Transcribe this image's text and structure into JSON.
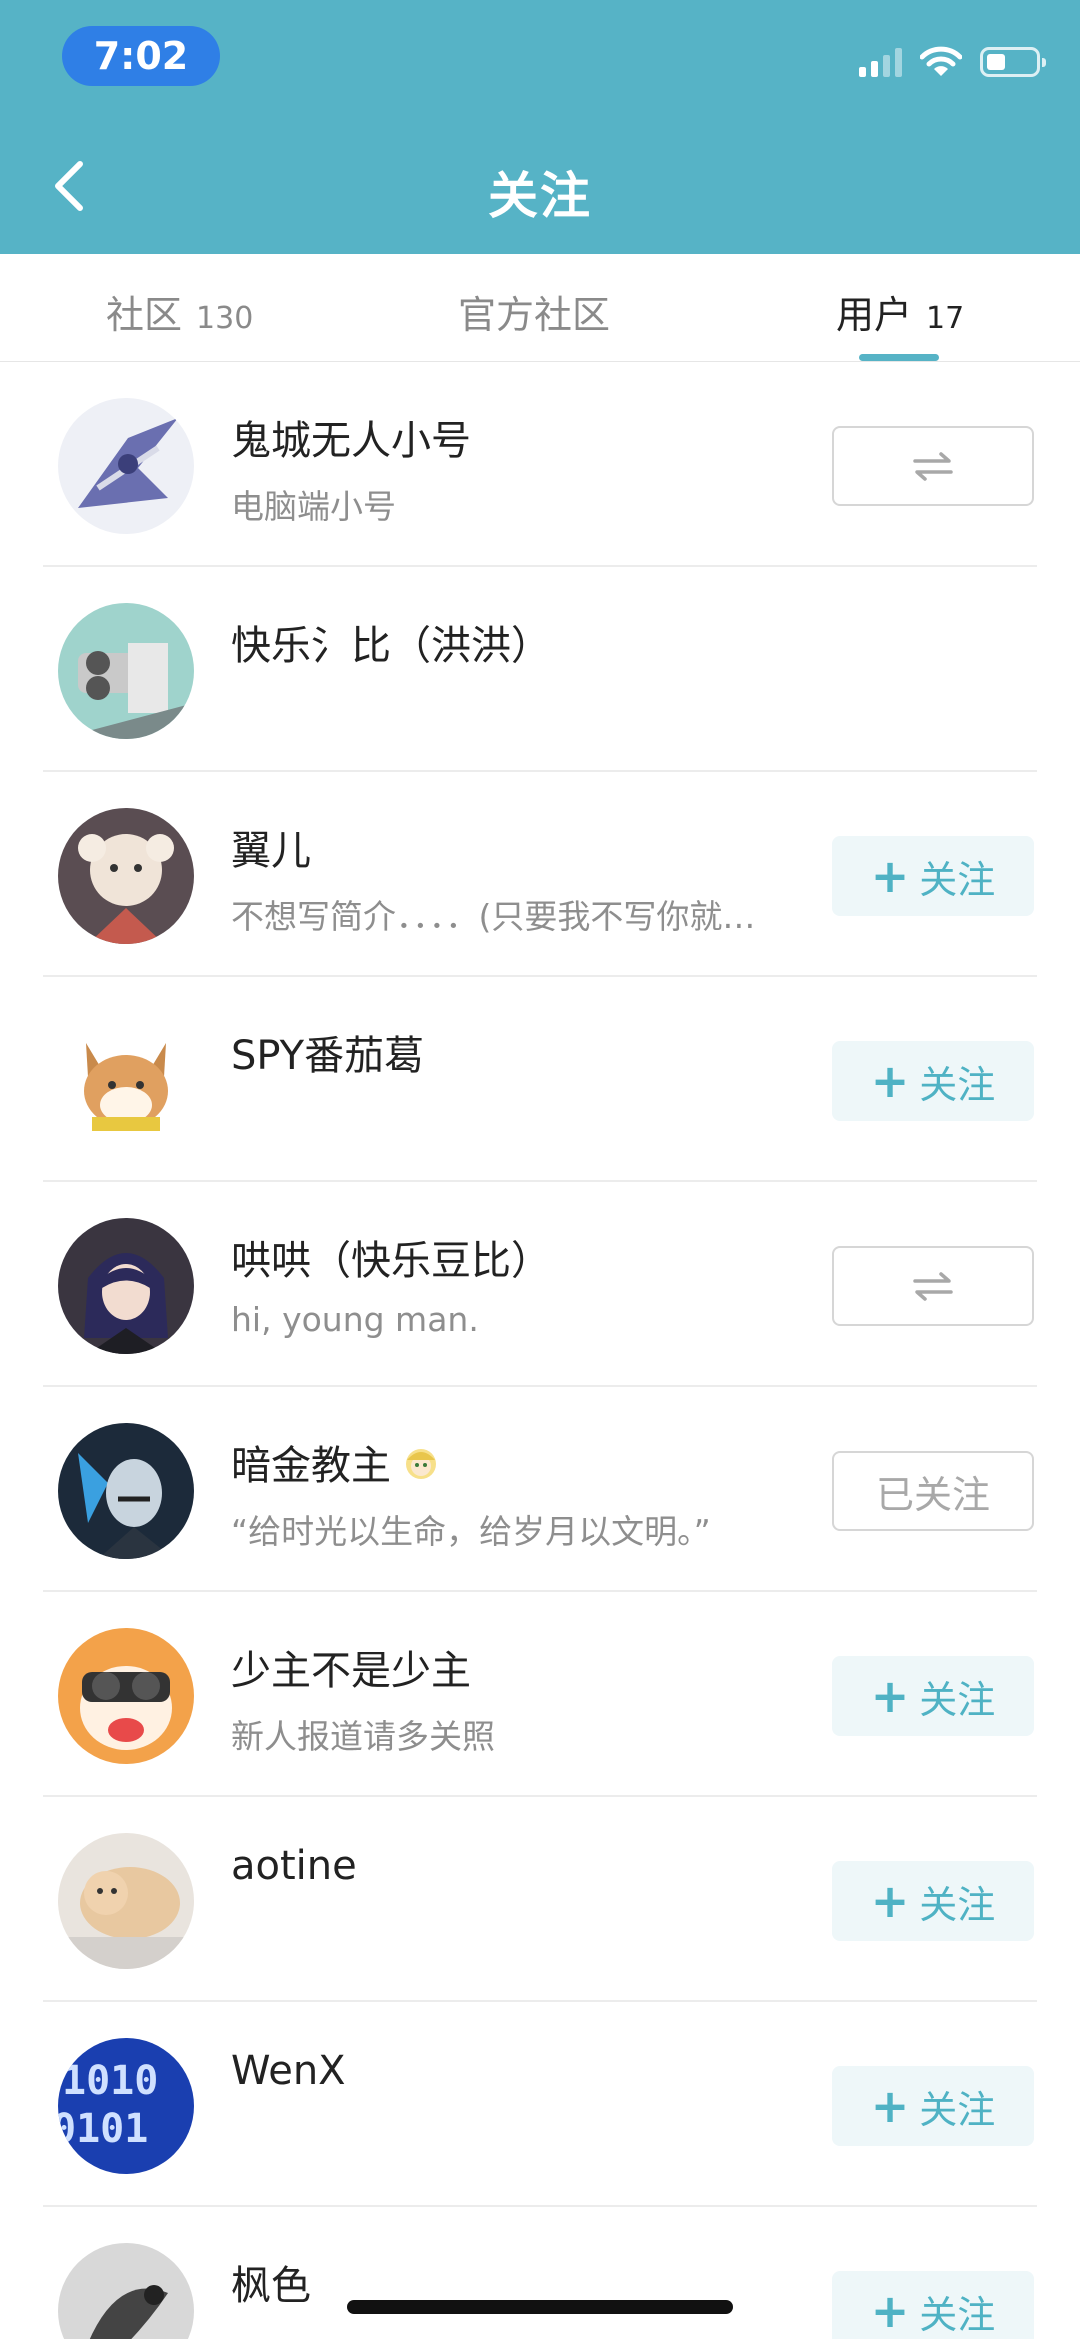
{
  "status_bar": {
    "time": "7:02"
  },
  "header": {
    "title": "关注"
  },
  "tabs": [
    {
      "label": "社区",
      "count": "130"
    },
    {
      "label": "官方社区",
      "count": ""
    },
    {
      "label": "用户",
      "count": "17"
    }
  ],
  "active_tab": "用户",
  "colors": {
    "accent": "#56b3c6",
    "follow_text": "#4fb2c4",
    "time_pill": "#2f7fe6"
  },
  "buttons": {
    "follow": "关注",
    "followed": "已关注",
    "mutual_icon": "swap-arrows-icon"
  },
  "users": [
    {
      "name": "鬼城无人小号",
      "bio": "电脑端小号",
      "state": "mutual"
    },
    {
      "name": "快乐氵比（洪洪）",
      "bio": "",
      "state": "none"
    },
    {
      "name": "翼儿",
      "bio": "不想写简介．．．．(只要我不写你就…",
      "state": "follow"
    },
    {
      "name": "SPY番茄葛",
      "bio": "",
      "state": "follow"
    },
    {
      "name": "哄哄（快乐豆比）",
      "bio": "hi, young man.",
      "state": "mutual"
    },
    {
      "name": "暗金教主",
      "bio": "“给时光以生命，给岁月以文明。”",
      "state": "followed",
      "badge": "avatar-sticker-icon"
    },
    {
      "name": "少主不是少主",
      "bio": "新人报道请多关照",
      "state": "follow"
    },
    {
      "name": "aotine",
      "bio": "",
      "state": "follow"
    },
    {
      "name": "WenX",
      "bio": "",
      "state": "follow"
    },
    {
      "name": "枫色",
      "bio": "",
      "state": "follow"
    }
  ]
}
